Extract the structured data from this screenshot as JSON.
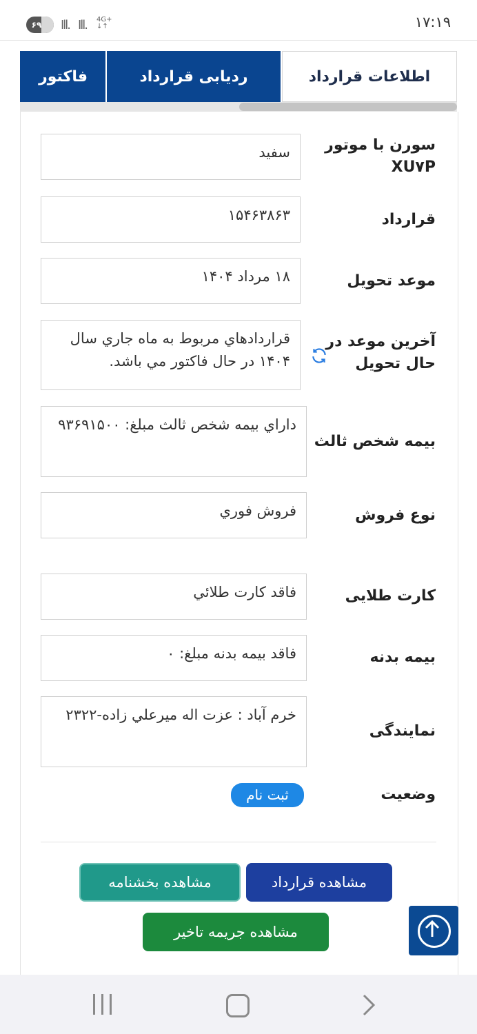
{
  "status_bar": {
    "time": "۱۷:۱۹",
    "battery": "۶۹",
    "network": "4G+",
    "signal": "Ill.",
    "signal2": "Ill."
  },
  "tabs": [
    {
      "label": "اطلاعات قرارداد",
      "active": true
    },
    {
      "label": "ردیابی قرارداد",
      "active": false
    },
    {
      "label": "فاکتور",
      "active": false
    }
  ],
  "fields": [
    {
      "label": "سورن با موتور XU۷P",
      "value": "سفید"
    },
    {
      "label": "قرارداد",
      "value": "۱۵۴۶۳۸۶۳"
    },
    {
      "label": "موعد تحویل",
      "value": "۱۸ مرداد ۱۴۰۴"
    },
    {
      "label": "آخرین موعد در حال تحویل",
      "value": "قراردادهاي مربوط به ماه جاري سال ۱۴۰۴ در حال فاکتور مي باشد."
    },
    {
      "label": "بیمه شخص ثالث",
      "value": "داراي بيمه شخص ثالث مبلغ: ۹۳۶۹۱۵۰۰"
    },
    {
      "label": "نوع فروش",
      "value": "فروش فوري"
    },
    {
      "label": "کارت طلایی",
      "value": "فاقد کارت طلائي"
    },
    {
      "label": "بیمه بدنه",
      "value": "فاقد بيمه بدنه مبلغ: ۰"
    },
    {
      "label": "نمایندگی",
      "value": "خرم آباد : عزت اله ميرعلي زاده-۲۳۲۲"
    }
  ],
  "status": {
    "label": "وضعیت",
    "value": "ثبت نام"
  },
  "buttons": {
    "view_contract": "مشاهده قرارداد",
    "view_circular": "مشاهده بخشنامه",
    "view_penalty": "مشاهده جريمه تاخير"
  },
  "colors": {
    "tab_blue": "#0a4590",
    "status_pill": "#1e88e5",
    "btn_contract": "#1d3f9f",
    "btn_circular": "#20998a",
    "btn_penalty": "#1c8a3d",
    "scroll_top": "#0b4a93"
  },
  "icons": {
    "refresh": "refresh-icon",
    "scroll_top": "arrow-up-circle-icon",
    "nav_recent": "recent-apps-icon",
    "nav_home": "home-icon",
    "nav_back": "back-icon"
  }
}
